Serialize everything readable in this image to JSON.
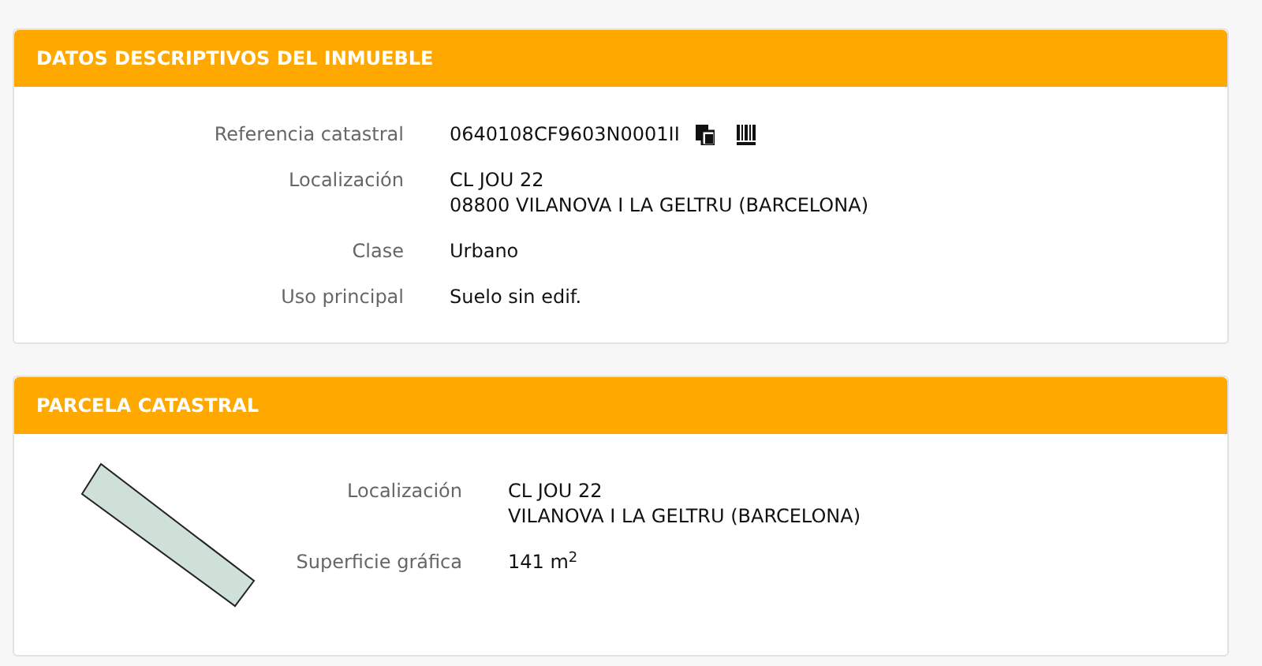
{
  "panels": [
    {
      "title": "DATOS DESCRIPTIVOS DEL INMUEBLE",
      "rows": [
        {
          "label": "Referencia catastral",
          "lines": [
            "0640108CF9603N0001II"
          ],
          "kind": "reference"
        },
        {
          "label": "Localización",
          "lines": [
            "CL JOU 22",
            "08800 VILANOVA I LA GELTRU (BARCELONA)"
          ],
          "kind": "text"
        },
        {
          "label": "Clase",
          "lines": [
            "Urbano"
          ],
          "kind": "text"
        },
        {
          "label": "Uso principal",
          "lines": [
            "Suelo sin edif."
          ],
          "kind": "text"
        }
      ]
    },
    {
      "title": "PARCELA CATASTRAL",
      "kind": "parcel",
      "rows": [
        {
          "label": "Localización",
          "lines": [
            "CL JOU 22",
            "VILANOVA I LA GELTRU (BARCELONA)"
          ],
          "kind": "text"
        },
        {
          "label": "Superficie gráfica",
          "lines": [
            "141 m$^{2}$"
          ],
          "kind": "text"
        }
      ]
    }
  ]
}
